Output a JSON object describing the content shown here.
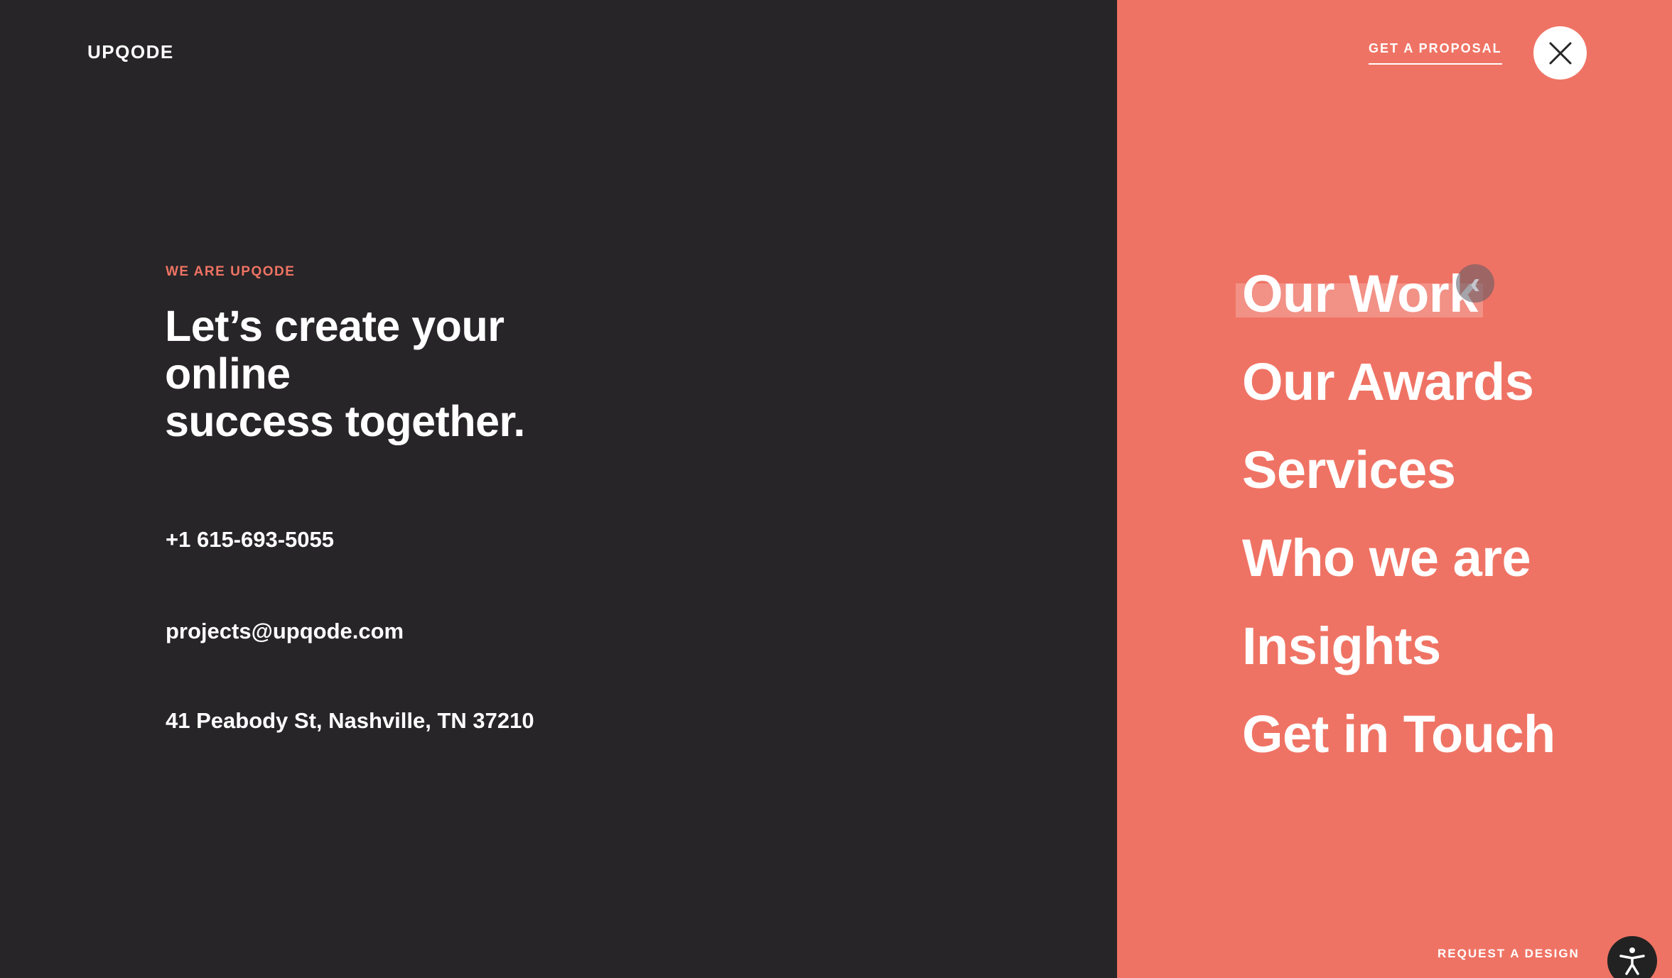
{
  "brand": {
    "logo_text": "UPQODE"
  },
  "hero": {
    "eyebrow": "WE ARE UPQODE",
    "headline_lines": [
      "Let’s create your",
      "online",
      "success together."
    ]
  },
  "contact": {
    "phone": "+1 615-693-5055",
    "email": "projects@upqode.com",
    "address": "41 Peabody St, Nashville, TN 37210"
  },
  "header": {
    "proposal_label": "GET A PROPOSAL",
    "close_icon": "close-icon"
  },
  "nav": {
    "items": [
      {
        "label": "Our Work"
      },
      {
        "label": "Our Awards"
      },
      {
        "label": "Services"
      },
      {
        "label": "Who we are"
      },
      {
        "label": "Insights"
      },
      {
        "label": "Get in Touch"
      }
    ]
  },
  "footer": {
    "request_label": "REQUEST A DESIGN",
    "accessibility_icon": "accessibility-icon"
  },
  "colors": {
    "left_bg": "#272527",
    "right_bg": "#ef7364",
    "accent": "#ef7364",
    "text": "#ffffff"
  }
}
